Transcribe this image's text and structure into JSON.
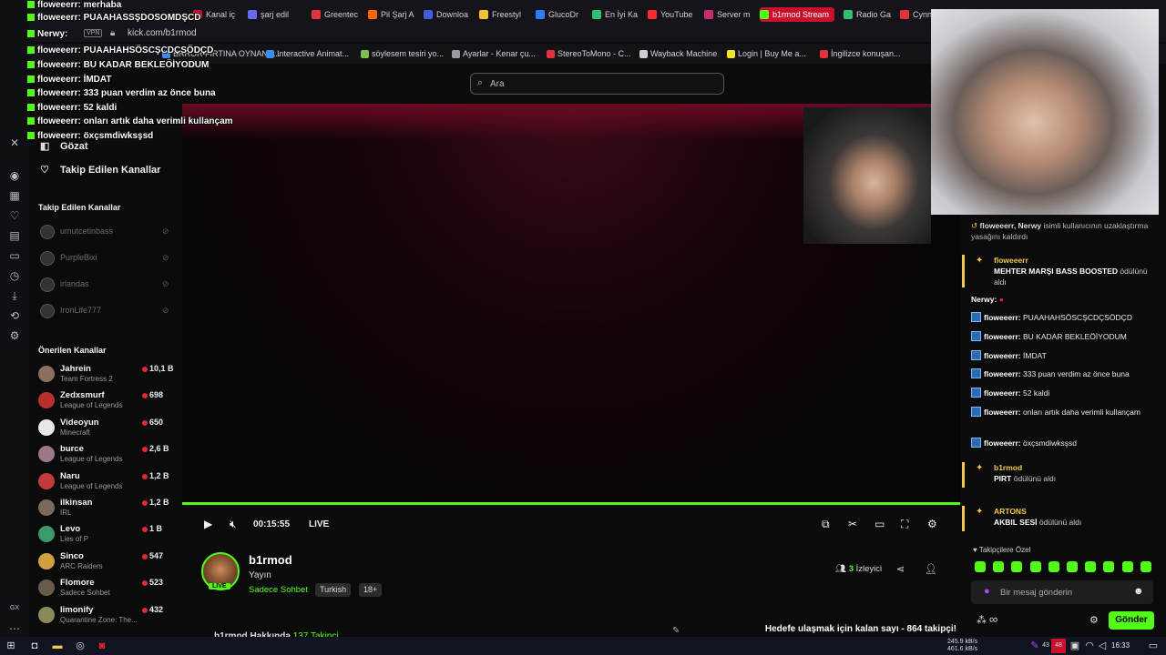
{
  "browser": {
    "tabs": [
      {
        "label": "Kanal iç",
        "color": "#c9102d"
      },
      {
        "label": "şarj edil",
        "color": "#6a6af0"
      },
      {
        "label": "Greentec",
        "color": "#e0333d"
      },
      {
        "label": "Pil Şarj A",
        "color": "#ff6600"
      },
      {
        "label": "Downloa",
        "color": "#4b5bd8"
      },
      {
        "label": "Freestyl",
        "color": "#f2c230"
      },
      {
        "label": "GlucoDr",
        "color": "#2e7cf6"
      },
      {
        "label": "En İyi Ka",
        "color": "#2fbf71"
      },
      {
        "label": "YouTube",
        "color": "#ff2b2b"
      },
      {
        "label": "Server m",
        "color": "#c92a6a"
      },
      {
        "label": "b1rmod Stream",
        "color": "#53fc18"
      },
      {
        "label": "Radio Ga",
        "color": "#2fbf71"
      },
      {
        "label": "Cynne",
        "color": "#e0333d"
      }
    ],
    "vpn_label": "VPN",
    "url": "kick.com/b1rmod",
    "bookmarks": [
      {
        "label": "ERROR FIRTINA OYNANA...",
        "color": "#3a8ef0"
      },
      {
        "label": "Interactive Animat...",
        "color": "#3a8ef0"
      },
      {
        "label": "söylesem tesiri yo...",
        "color": "#7cc04a"
      },
      {
        "label": "Ayarlar - Kenar çu...",
        "color": "#9a9aa0"
      },
      {
        "label": "StereoToMono - C...",
        "color": "#e0333d"
      },
      {
        "label": "Wayback Machine",
        "color": "#cfcfcf"
      },
      {
        "label": "Login | Buy Me a...",
        "color": "#f2e230"
      },
      {
        "label": "İngilizce konuşan...",
        "color": "#e0333d"
      }
    ]
  },
  "search": {
    "placeholder": "Ara"
  },
  "overlay_chat": [
    {
      "user": "floweeerr",
      "text": "merhaba"
    },
    {
      "user": "floweeerr",
      "text": "PUAAHASSŞDOSOMDŞCD"
    },
    {
      "user": "Nerwy",
      "text": ""
    },
    {
      "user": "floweeerr",
      "text": "PUAAHAHSÖSCŞCDÇSÖDÇD"
    },
    {
      "user": "floweeerr",
      "text": "BU KADAR BEKLEÖİYODUM"
    },
    {
      "user": "floweeerr",
      "text": "İMDAT"
    },
    {
      "user": "floweeerr",
      "text": "333 puan verdim az önce buna"
    },
    {
      "user": "floweeerr",
      "text": "52 kaldi"
    },
    {
      "user": "floweeerr",
      "text": "onları artık daha verimli kullançam"
    },
    {
      "user": "floweeerr",
      "text": "öxçsmdiwksşsd"
    }
  ],
  "nav": {
    "browse": "Gözat",
    "following": "Takip Edilen Kanallar"
  },
  "followed": {
    "heading": "Takip Edilen Kanallar",
    "items": [
      {
        "name": "umutcetinbass"
      },
      {
        "name": "PurpleBixi"
      },
      {
        "name": "irlandas"
      },
      {
        "name": "IronLife777"
      }
    ]
  },
  "recommended": {
    "heading": "Önerilen Kanallar",
    "items": [
      {
        "name": "Jahrein",
        "category": "Team Fortress 2",
        "viewers": "10,1 B",
        "color": "#8a7060"
      },
      {
        "name": "Zedxsmurf",
        "category": "League of Legends",
        "viewers": "698",
        "color": "#b8302c"
      },
      {
        "name": "Videoyun",
        "category": "Minecraft",
        "viewers": "650",
        "color": "#e8e8e8"
      },
      {
        "name": "burce",
        "category": "League of Legends",
        "viewers": "2,6 B",
        "color": "#9a7a8a"
      },
      {
        "name": "Naru",
        "category": "League of Legends",
        "viewers": "1,2 B",
        "color": "#c23a3a"
      },
      {
        "name": "ilkinsan",
        "category": "IRL",
        "viewers": "1,2 B",
        "color": "#7a6a5a"
      },
      {
        "name": "Levo",
        "category": "Lies of P",
        "viewers": "1 B",
        "color": "#3a9a6a"
      },
      {
        "name": "Sinco",
        "category": "ARC Raiders",
        "viewers": "547",
        "color": "#d0a040"
      },
      {
        "name": "Flomore",
        "category": "Sadece Sohbet",
        "viewers": "523",
        "color": "#6a5a4a"
      },
      {
        "name": "limonify",
        "category": "Quarantine Zone: The...",
        "viewers": "432",
        "color": "#8a8a5a"
      }
    ]
  },
  "player": {
    "time": "00:15:55",
    "live_label": "LIVE",
    "progress": 1.0
  },
  "channel": {
    "name": "b1rmod",
    "title": "Yayın",
    "category": "Sadece Sohbet",
    "tags": [
      "Turkish",
      "18+"
    ],
    "live_badge": "LIVE",
    "viewers_count": "3",
    "viewers_label": "İzleyici",
    "about": "b1rmod Hakkında",
    "followers": "137 Takipçi",
    "goal": "Hedefe ulaşmak için kalan sayı - 864 takipçi!"
  },
  "chat": {
    "ban_notice_users": "floweeerr, Nerwy",
    "ban_notice_text": "isimli kullanıcının uzaklaştırma yasağını kaldırdı",
    "reward1_user": "floweeerr",
    "reward1_title": "MEHTER MARŞI BASS BOOSTED",
    "reward1_suffix": "ödülünü aldı",
    "nerwy_user": "Nerwy:",
    "messages": [
      {
        "user": "floweeerr:",
        "text": "PUAAHAHSÖSCŞCDÇSÖDÇD"
      },
      {
        "user": "floweeerr:",
        "text": "BU KADAR BEKLEÖİYODUM"
      },
      {
        "user": "floweeerr:",
        "text": "İMDAT"
      },
      {
        "user": "floweeerr:",
        "text": "333 puan verdim az önce buna"
      },
      {
        "user": "floweeerr:",
        "text": "52 kaldi"
      },
      {
        "user": "floweeerr:",
        "text": "onları artık daha verimli kullançam"
      },
      {
        "user": "floweeerr:",
        "text": "öxçsmdiwksşsd"
      }
    ],
    "reward2_user": "b1rmod",
    "reward2_title": "PIRT",
    "reward2_suffix": "ödülünü aldı",
    "reward3_user": "ARTONS",
    "reward3_title": "AKBIL SESİ",
    "reward3_suffix": "ödülünü aldı",
    "followers_only": "Takipçilere Özel",
    "input_placeholder": "Bir mesaj gönderin",
    "send_label": "Gönder",
    "infinity": "∞"
  },
  "taskbar": {
    "net_up": "245.9 kB/s",
    "net_down": "461.6 kB/s",
    "clock": "16:33",
    "badge1": "43",
    "badge2": "48"
  },
  "colors": {
    "accent": "#53fc18",
    "live_dot": "#e8262f",
    "reward": "#f2c94c"
  }
}
